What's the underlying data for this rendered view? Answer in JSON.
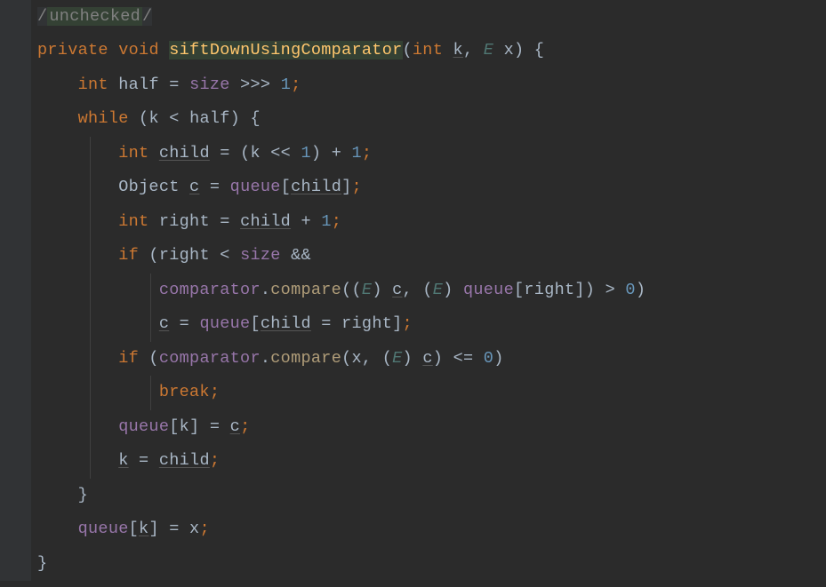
{
  "code": {
    "l0": {
      "comment": "/unchecked/"
    },
    "l1": {
      "kw1": "private",
      "kw2": "void",
      "method": "siftDownUsingComparator",
      "p_open": "(",
      "kw3": "int",
      "param1": "k",
      "comma": ", ",
      "type": "E",
      "param2": "x",
      "p_close": ") {"
    },
    "l2": {
      "kw": "int",
      "id": "half",
      "eq": " = ",
      "field": "size",
      "op": " >>> ",
      "num": "1",
      "semi": ";"
    },
    "l3": {
      "kw": "while",
      "open": " (",
      "id": "k",
      "op": " < ",
      "id2": "half",
      "close": ") {"
    },
    "l4": {
      "kw": "int",
      "id": "child",
      "eq": " = (",
      "id2": "k",
      "op": " << ",
      "num": "1",
      "close": ") + ",
      "num2": "1",
      "semi": ";"
    },
    "l5": {
      "type": "Object",
      "id": "c",
      "eq": " = ",
      "field": "queue",
      "open": "[",
      "id2": "child",
      "close": "];"
    },
    "l6": {
      "kw": "int",
      "id": "right",
      "eq": " = ",
      "id2": "child",
      "op": " + ",
      "num": "1",
      "semi": ";"
    },
    "l7": {
      "kw": "if",
      "open": " (",
      "id": "right",
      "op": " < ",
      "field": "size",
      "and": " &&"
    },
    "l8": {
      "field": "comparator",
      "dot": ".",
      "call": "compare",
      "open": "((",
      "type": "E",
      "close1": ") ",
      "id": "c",
      "comma": ", (",
      "type2": "E",
      "close2": ") ",
      "field2": "queue",
      "br_o": "[",
      "id2": "right",
      "br_c": "]) > ",
      "num": "0",
      "end": ")"
    },
    "l9": {
      "id": "c",
      "eq": " = ",
      "field": "queue",
      "open": "[",
      "id2": "child",
      "eq2": " = ",
      "id3": "right",
      "close": "];"
    },
    "l10": {
      "kw": "if",
      "open": " (",
      "field": "comparator",
      "dot": ".",
      "call": "compare",
      "p_open": "(",
      "id": "x",
      "comma": ", (",
      "type": "E",
      "close": ") ",
      "id2": "c",
      "end": ") <= ",
      "num": "0",
      "p_close": ")"
    },
    "l11": {
      "kw": "break",
      "semi": ";"
    },
    "l12": {
      "field": "queue",
      "open": "[",
      "id": "k",
      "close": "] = ",
      "id2": "c",
      "semi": ";"
    },
    "l13": {
      "id": "k",
      "eq": " = ",
      "id2": "child",
      "semi": ";"
    },
    "l14": {
      "brace": "}"
    },
    "l15": {
      "field": "queue",
      "open": "[",
      "id": "k",
      "close": "] = ",
      "id2": "x",
      "semi": ";"
    },
    "l16": {
      "brace": "}"
    }
  }
}
